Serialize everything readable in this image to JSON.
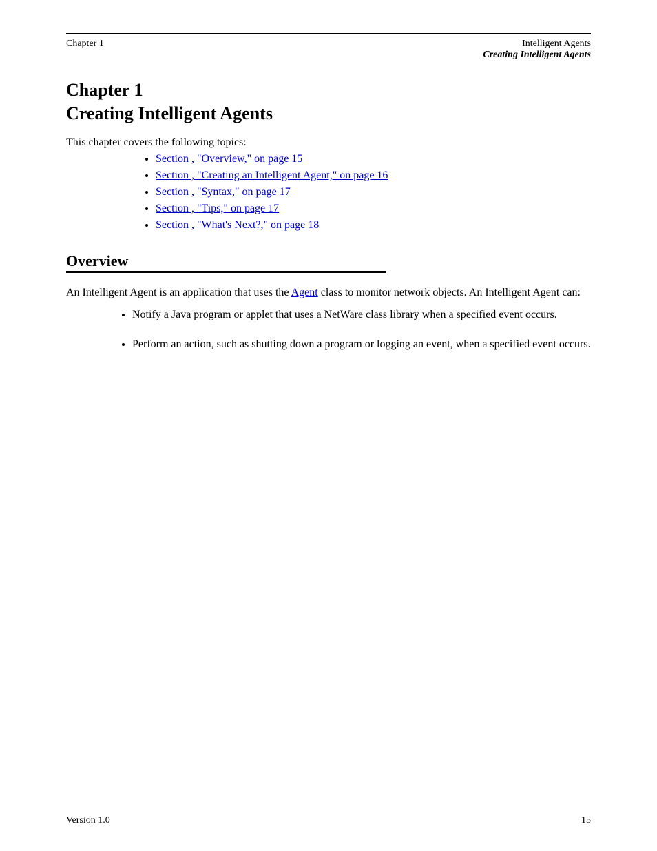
{
  "header": {
    "left": "Chapter 1",
    "right_line1": "Intelligent Agents",
    "right_line2": "Creating Intelligent Agents"
  },
  "chapter": {
    "number": "Chapter 1",
    "title": "Creating Intelligent Agents"
  },
  "intro": "This chapter covers the following topics:",
  "links": [
    "Section , \"Overview,\" on page 15",
    "Section , \"Creating an Intelligent Agent,\" on page 16",
    "Section , \"Syntax,\" on page 17",
    "Section , \"Tips,\" on page 17",
    "Section , \"What's Next?,\" on page 18"
  ],
  "section": {
    "title": "Overview"
  },
  "body": {
    "p1_before_link": "An Intelligent Agent is an application that uses the ",
    "p1_link": "Agent",
    "p1_after_link": " class to monitor network objects. An Intelligent Agent can:",
    "bullets": [
      "Notify a Java program or applet that uses a NetWare class library when a specified event occurs.",
      "Perform an action, such as shutting down a program or logging an event, when a specified event occurs."
    ]
  },
  "footer": {
    "left": "Version 1.0",
    "right": "15"
  }
}
